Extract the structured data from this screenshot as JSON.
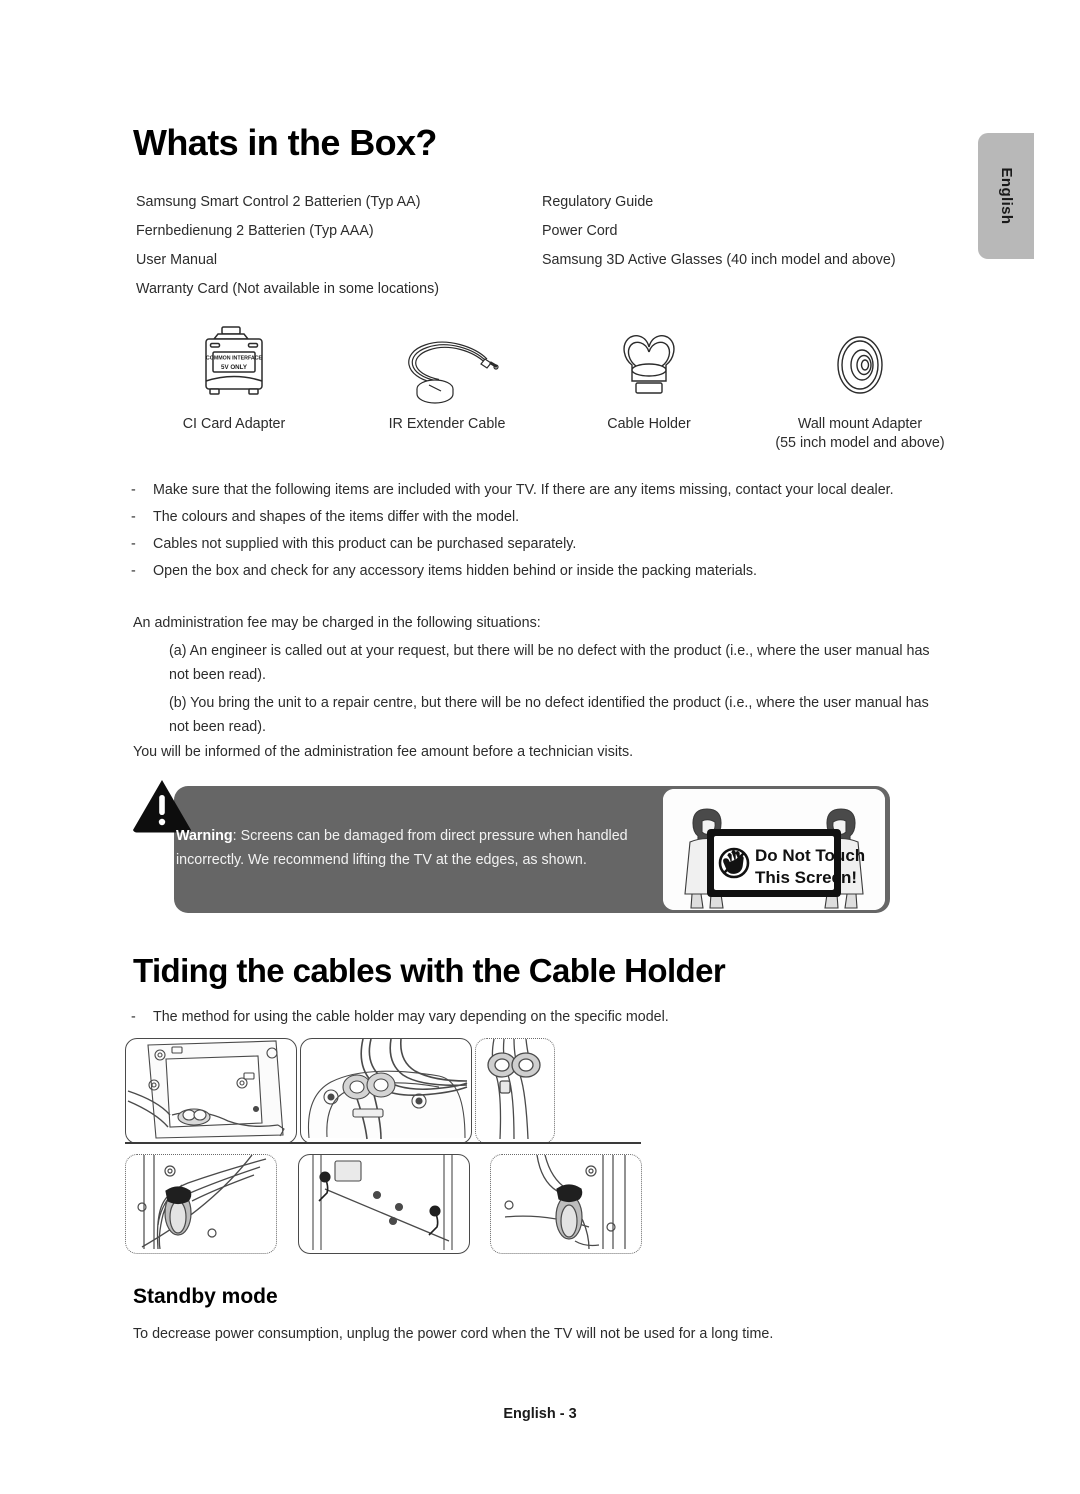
{
  "page": {
    "language_tab": "English",
    "footer": "English - 3"
  },
  "section_box": {
    "title": "Whats in the Box?",
    "items_left": [
      "Samsung Smart Control 2 Batterien (Typ AA)",
      "Fernbedienung 2 Batterien (Typ AAA)",
      "User Manual",
      "Warranty Card (Not available in some locations)"
    ],
    "items_right": [
      "Regulatory Guide",
      "Power Cord",
      "Samsung 3D Active Glasses (40 inch model and above)"
    ],
    "accessories": [
      {
        "icon": "ci-card-adapter-icon",
        "label": "CI Card Adapter",
        "sub": "",
        "art_text_top": "COMMON INTERFACE",
        "art_text_bottom": "5V ONLY"
      },
      {
        "icon": "ir-extender-cable-icon",
        "label": "IR Extender Cable",
        "sub": ""
      },
      {
        "icon": "cable-holder-icon",
        "label": "Cable Holder",
        "sub": ""
      },
      {
        "icon": "wall-mount-adapter-icon",
        "label": "Wall mount Adapter",
        "sub": "(55 inch model and above)"
      }
    ],
    "notes": [
      "Make sure that the following items are included with your TV. If there are any items missing, contact your local dealer.",
      "The colours and shapes of the items differ with the model.",
      "Cables not supplied with this product can be purchased separately.",
      "Open the box and check for any accessory items hidden behind or inside the packing materials."
    ],
    "bullet_dash": "-",
    "admin_fee": {
      "intro": "An administration fee may be charged in the following situations:",
      "case_a": "(a) An engineer is called out at your request, but there will be no defect with the product (i.e., where the user manual has not been read).",
      "case_b": "(b) You bring the unit to a repair centre, but there will be no defect identified the product (i.e., where the user manual has not been read).",
      "outro": "You will be informed of the administration fee amount before a technician visits."
    },
    "warning": {
      "label": "Warning",
      "text": ": Screens can be damaged from direct pressure when handled incorrectly. We recommend lifting the TV at the edges, as shown.",
      "graphic_line1": "Do Not Touch",
      "graphic_line2": "This Screen!"
    }
  },
  "section_cables": {
    "title": "Tiding the cables with the Cable Holder",
    "note": "The method for using the cable holder may vary depending on the specific model.",
    "bullet_dash": "-"
  },
  "section_standby": {
    "title": "Standby mode",
    "text": "To decrease power consumption, unplug the power cord when the TV will not be used for a long time."
  },
  "colors": {
    "warning_bg": "#666666",
    "lang_tab_bg": "#b8b8b8",
    "text": "#2c2c2c"
  }
}
